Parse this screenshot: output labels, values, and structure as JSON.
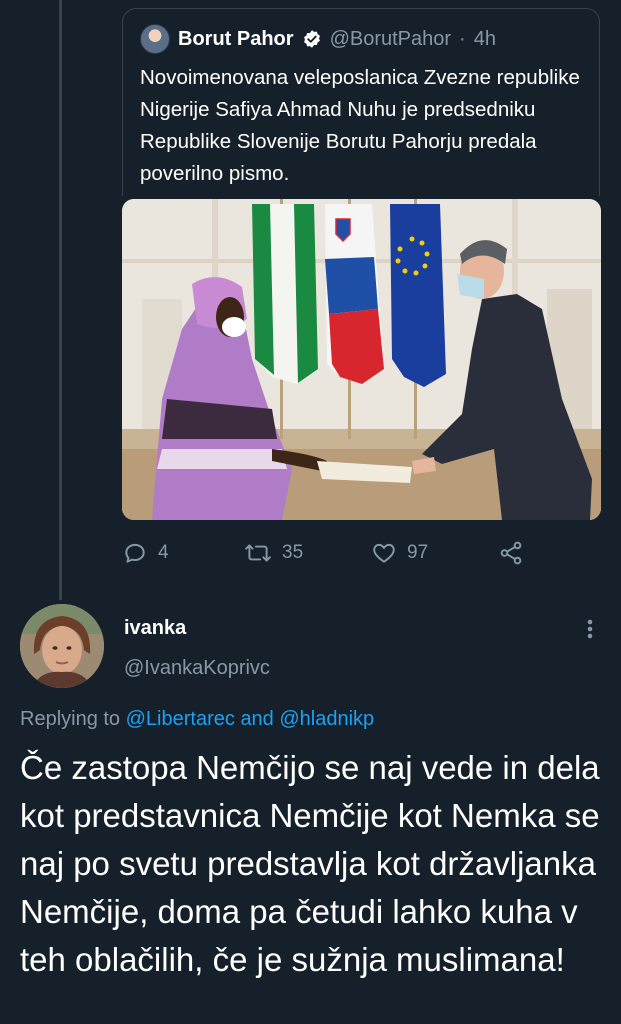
{
  "quoted_tweet": {
    "name": "Borut Pahor",
    "handle": "@BorutPahor",
    "separator": "·",
    "time": "4h",
    "text": "Novoimenovana veleposlanica Zvezne republike Nigerije Safiya Ahmad Nuhu je predsedniku Republike Slovenije Borutu Pahorju predala poverilno pismo.",
    "verified_icon": "verified-badge-icon"
  },
  "actions": {
    "replies": "4",
    "retweets": "35",
    "likes": "97",
    "icons": [
      "reply-icon",
      "retweet-icon",
      "like-icon",
      "share-icon"
    ]
  },
  "reply": {
    "name": "ivanka",
    "handle": "@IvankaKoprivc",
    "replying_prefix": "Replying to",
    "mention_1": "@Libertarec",
    "and_word": "and",
    "mention_2": "@hladnikp",
    "text": "Če zastopa Nemčijo se naj vede in dela kot predstavnica Nemčije kot Nemka se naj po svetu predstavlja kot državljanka Nemčije, doma pa četudi lahko kuha v teh oblačilih, če je sužnja muslimana!"
  },
  "colors": {
    "background": "#15202b",
    "secondary_text": "#8899a6",
    "link": "#1da1f2",
    "border": "#38444d"
  }
}
